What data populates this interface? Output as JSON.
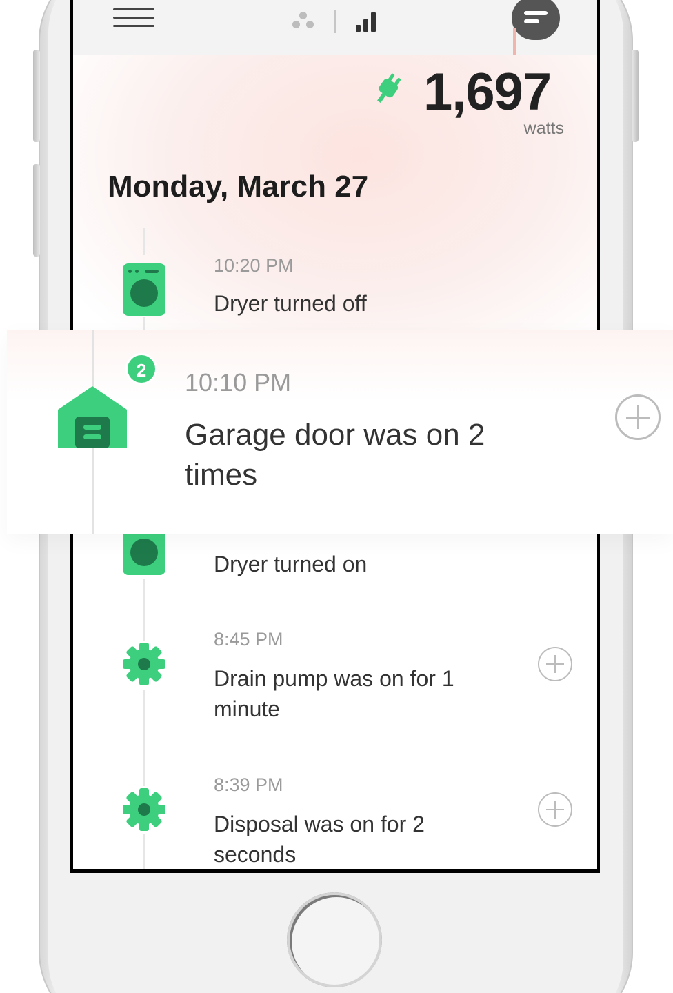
{
  "icons": {
    "menu": "hamburger-menu-icon",
    "devices": "devices-dots-icon",
    "stats": "signal-bars-icon",
    "chat": "chat-bubble-icon",
    "power": "power-plug-icon"
  },
  "colors": {
    "accent_green": "#3ecf7e",
    "dark_green": "#1e7a4b",
    "glow_pink": "#fde4e0"
  },
  "power": {
    "value": "1,697",
    "unit": "watts"
  },
  "timeline": {
    "date": "Monday, March 27",
    "events": [
      {
        "time": "10:20 PM",
        "title": "Dryer turned off",
        "icon": "dryer-icon"
      },
      {
        "time": "10:10 PM",
        "title": "Garage door was on 2 times",
        "icon": "garage-icon",
        "badge": "2",
        "highlighted": true
      },
      {
        "time": "",
        "title": "Dryer turned on",
        "icon": "dryer-icon"
      },
      {
        "time": "8:45 PM",
        "title": "Drain pump was on for 1 minute",
        "icon": "gear-icon"
      },
      {
        "time": "8:39 PM",
        "title": "Disposal was on for 2 seconds",
        "icon": "gear-icon"
      }
    ]
  }
}
